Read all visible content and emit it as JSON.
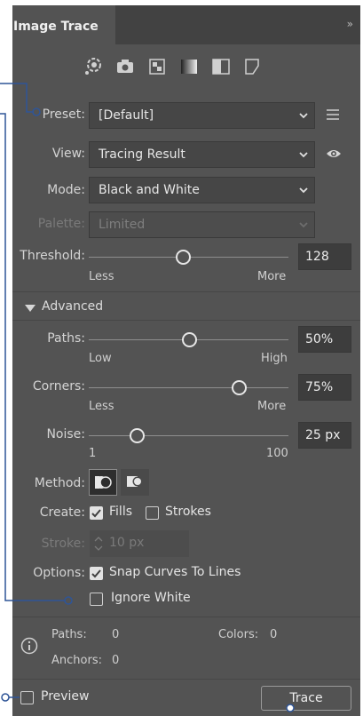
{
  "panel": {
    "title": "Image Trace",
    "collapse_glyph": "»"
  },
  "presets": [
    {
      "name": "auto-color-preset-icon"
    },
    {
      "name": "high-color-photo-preset-icon"
    },
    {
      "name": "low-color-preset-icon"
    },
    {
      "name": "grayscale-preset-icon"
    },
    {
      "name": "black-and-white-preset-icon"
    },
    {
      "name": "outline-preset-icon"
    }
  ],
  "preset": {
    "label": "Preset:",
    "value": "[Default]"
  },
  "view": {
    "label": "View:",
    "value": "Tracing Result"
  },
  "mode": {
    "label": "Mode:",
    "value": "Black and White"
  },
  "palette": {
    "label": "Palette:",
    "value": "Limited"
  },
  "threshold": {
    "label": "Threshold:",
    "value": "128",
    "min_label": "Less",
    "max_label": "More",
    "level": 0.47
  },
  "advanced": {
    "label": "Advanced"
  },
  "paths": {
    "label": "Paths:",
    "value": "50%",
    "min_label": "Low",
    "max_label": "High",
    "level": 0.5
  },
  "corners": {
    "label": "Corners:",
    "value": "75%",
    "min_label": "Less",
    "max_label": "More",
    "level": 0.75
  },
  "noise": {
    "label": "Noise:",
    "value": "25 px",
    "min_label": "1",
    "max_label": "100",
    "level": 0.24
  },
  "method": {
    "label": "Method:"
  },
  "create": {
    "label": "Create:",
    "fills": "Fills",
    "strokes": "Strokes",
    "fills_checked": true,
    "strokes_checked": false
  },
  "stroke": {
    "label": "Stroke:",
    "value": "10 px"
  },
  "options": {
    "label": "Options:",
    "snap": "Snap Curves To Lines",
    "ignore_white": "Ignore White",
    "snap_checked": true,
    "ignore_checked": false
  },
  "info": {
    "paths_label": "Paths:",
    "paths_value": "0",
    "colors_label": "Colors:",
    "colors_value": "0",
    "anchors_label": "Anchors:",
    "anchors_value": "0"
  },
  "footer": {
    "preview": "Preview",
    "trace": "Trace"
  },
  "colors": {
    "callout": "#2f5597",
    "panel": "#535353",
    "tab_bar": "#424242"
  }
}
